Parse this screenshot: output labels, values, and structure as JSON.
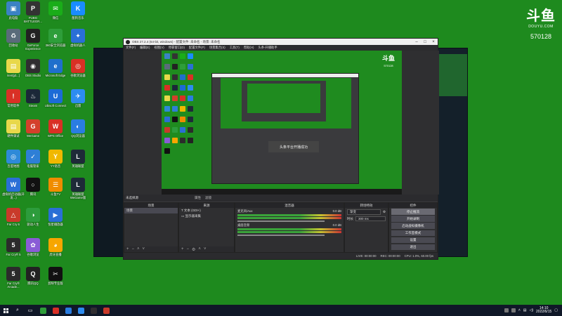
{
  "desktop_icons": [
    {
      "label": "此电脑",
      "glyph": "▣",
      "color": "#3b82c4"
    },
    {
      "label": "PUBG BATTLEGR...",
      "glyph": "P",
      "color": "#333333"
    },
    {
      "label": "微信",
      "glyph": "✉",
      "color": "#1aad19"
    },
    {
      "label": "酷狗音乐",
      "glyph": "K",
      "color": "#1a8cff"
    },
    {
      "label": "回收站",
      "glyph": "♻",
      "color": "#5a6b7a"
    },
    {
      "label": "GeForce Experience",
      "glyph": "G",
      "color": "#222222"
    },
    {
      "label": "360安全浏览器",
      "glyph": "e",
      "color": "#2e9e3a"
    },
    {
      "label": "虚拟机器人",
      "glyph": "✦",
      "color": "#2a6fd6"
    },
    {
      "label": "item[jd...]",
      "glyph": "▤",
      "color": "#e8d84a"
    },
    {
      "label": "OBS Studio",
      "glyph": "◉",
      "color": "#302e31"
    },
    {
      "label": "Microsoft Edge",
      "glyph": "e",
      "color": "#1f6fcc"
    },
    {
      "label": "谷歌浏览器",
      "glyph": "◎",
      "color": "#d93025"
    },
    {
      "label": "常用软件",
      "glyph": "!",
      "color": "#d93025"
    },
    {
      "label": "Steam",
      "glyph": "♨",
      "color": "#1b2838"
    },
    {
      "label": "Ubisoft Connect",
      "glyph": "U",
      "color": "#1c6bd6"
    },
    {
      "label": "迅雷",
      "glyph": "✈",
      "color": "#2d8cf0"
    },
    {
      "label": "硬件调试",
      "glyph": "▤",
      "color": "#e8d84a"
    },
    {
      "label": "WeGame",
      "glyph": "G",
      "color": "#d4402b"
    },
    {
      "label": "WPS Office",
      "glyph": "W",
      "color": "#d93025"
    },
    {
      "label": "QQ浏览器",
      "glyph": "◐",
      "color": "#2a7de1"
    },
    {
      "label": "百度地图",
      "glyph": "◎",
      "color": "#2e8ad8"
    },
    {
      "label": "电脑管家",
      "glyph": "✓",
      "color": "#2e7fd6"
    },
    {
      "label": "YY语音",
      "glyph": "Y",
      "color": "#f0b800"
    },
    {
      "label": "英雄联盟",
      "glyph": "L",
      "color": "#1e2a38"
    },
    {
      "label": "虚拟机启动器(开发...)",
      "glyph": "W",
      "color": "#2a6fd6"
    },
    {
      "label": "腾讯",
      "glyph": "○",
      "color": "#111111"
    },
    {
      "label": "斗鱼TV",
      "glyph": "☰",
      "color": "#f08c00"
    },
    {
      "label": "英雄联盟 WeGame版",
      "glyph": "L",
      "color": "#1e2a38"
    },
    {
      "label": "Far Cry 6",
      "glyph": "△",
      "color": "#c93a2a"
    },
    {
      "label": "驱动人生",
      "glyph": "◑",
      "color": "#2d9c3c"
    },
    {
      "label": "恒星播放器",
      "glyph": "▶",
      "color": "#2a6fd6"
    },
    {
      "label": "Far Cry® 5",
      "glyph": "5",
      "color": "#2b2b2b"
    },
    {
      "label": "谷歌浏览",
      "glyph": "✿",
      "color": "#8a5cd6"
    },
    {
      "label": "虎牙直播",
      "glyph": "◕",
      "color": "#f7a600"
    },
    {
      "label": "Far Cry® Arcade...",
      "glyph": "5",
      "color": "#2b2b2b"
    },
    {
      "label": "腾讯QQ",
      "glyph": "Q",
      "color": "#222222"
    },
    {
      "label": "剪映专业版",
      "glyph": "✂",
      "color": "#111111"
    }
  ],
  "brand": {
    "logo": "斗鱼",
    "domain": "DOUYU.COM",
    "room_id": "570128"
  },
  "obs": {
    "title": "OBS 27.2.4 (64-bit, windows) - 配置文件: 未命名 - 场景: 未命名",
    "menu": [
      "文件(F)",
      "编辑(E)",
      "视图(V)",
      "停靠窗口(D)",
      "配置文件(P)",
      "场景集合(S)",
      "工具(T)",
      "帮助(H)",
      "头条-开播助手"
    ],
    "preview_banner": "头条平台开播成功",
    "transition_bar_label": "未选择源",
    "transition_bar_buttons": [
      "属性",
      "滤镜"
    ],
    "docks": {
      "scenes": {
        "title": "场景",
        "items": [
          "场景"
        ]
      },
      "sources": {
        "title": "来源",
        "items": [
          "文本 (GDI+)",
          "显示器采集"
        ]
      },
      "mixer": {
        "title": "混音器",
        "channels": [
          {
            "name": "麦克风/Aux",
            "db": "0.0 dB"
          },
          {
            "name": "桌面音频",
            "db": "0.0 dB"
          }
        ]
      },
      "transitions": {
        "title": "转场特效",
        "mode_label": "渐变",
        "duration_label": "时长",
        "duration_value": "300 ms"
      },
      "controls": {
        "title": "控件",
        "buttons": [
          "停止推流",
          "开始录制",
          "启动虚拟摄像机",
          "工作室模式",
          "设置",
          "退出"
        ]
      }
    },
    "status": [
      "LIVE: 00:00:00",
      "REC: 00:00:00",
      "CPU: 1.0%, 60.00 fps"
    ]
  },
  "taskbar": {
    "apps": [
      {
        "name": "search",
        "glyph": "⌕",
        "color": "#ffffff"
      },
      {
        "name": "task-view",
        "glyph": "▭",
        "color": "#ffffff"
      },
      {
        "name": "360-browser",
        "glyph": "",
        "color": "#2e9e3a"
      },
      {
        "name": "chrome",
        "glyph": "",
        "color": "#d93025"
      },
      {
        "name": "qq-browser",
        "glyph": "",
        "color": "#2a7de1"
      },
      {
        "name": "thunder",
        "glyph": "",
        "color": "#2d8cf0"
      },
      {
        "name": "obs",
        "glyph": "",
        "color": "#302e31"
      },
      {
        "name": "record",
        "glyph": "",
        "color": "#c93a2a"
      }
    ],
    "time": "14:10",
    "date": "2022/6/15"
  }
}
